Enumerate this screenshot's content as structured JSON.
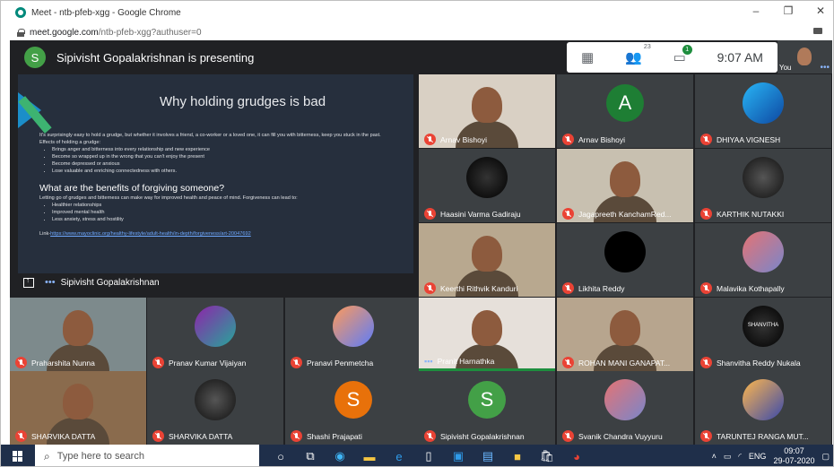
{
  "browser": {
    "tab_title": "Meet - ntb-pfeb-xgg - Google Chrome",
    "url_host": "meet.google.com",
    "url_path": "/ntb-pfeb-xgg?authuser=0",
    "controls": {
      "minimize": "–",
      "restore": "❐",
      "close": "✕"
    }
  },
  "meet": {
    "presenter_initial": "S",
    "presenting_text": "Sipivisht Gopalakrishnan is presenting",
    "participant_count": "23",
    "chat_badge": "1",
    "time": "9:07 AM",
    "self_label": "You",
    "presenter_label": "Sipivisht Gopalakrishnan",
    "slide": {
      "title": "Why holding grudges is bad",
      "intro": "It's surprisingly easy to hold a grudge, but whether it involves a friend, a co-worker or a loved one, it can fill you with bitterness, keep you stuck in the past.",
      "effects_heading": "Effects of holding a grudge:",
      "effects": [
        "Brings anger and bitterness into every relationship and new experience",
        "Become so wrapped up in the wrong that you can't enjoy the present",
        "Become depressed or anxious",
        "Lose valuable and enriching connectedness with others."
      ],
      "subtitle": "What are the benefits of forgiving someone?",
      "benefits_intro": "Letting go of grudges and bitterness can make way for improved health and peace of mind. Forgiveness can lead to:",
      "benefits": [
        "Healthier relationships",
        "Improved mental health",
        "Less anxiety, stress and hostility"
      ],
      "link_label": "Link-",
      "link_url": "https://www.mayoclinic.org/healthy-lifestyle/adult-health/in-depth/forgiveness/art-20047692"
    },
    "tiles": [
      {
        "name": "Arnav Bishoyi",
        "kind": "video"
      },
      {
        "name": "Arnav Bishoyi",
        "kind": "initial",
        "initial": "A",
        "color": "#1e7e34"
      },
      {
        "name": "DHIYAA VIGNESH",
        "kind": "photo"
      },
      {
        "name": "Haasini Varma Gadiraju",
        "kind": "photo"
      },
      {
        "name": "Jagapreeth KanchamRed...",
        "kind": "video"
      },
      {
        "name": "KARTHIK NUTAKKI",
        "kind": "photo"
      },
      {
        "name": "Keerthi Rithvik Kanduri",
        "kind": "video"
      },
      {
        "name": "Likhita Reddy",
        "kind": "photo"
      },
      {
        "name": "Malavika Kothapally",
        "kind": "photo"
      },
      {
        "name": "Praharshita Nunna",
        "kind": "video"
      },
      {
        "name": "Pranav Kumar Vijaiyan",
        "kind": "photo"
      },
      {
        "name": "Pranavi Penmetcha",
        "kind": "photo"
      },
      {
        "name": "Pranit Harnathka",
        "kind": "video"
      },
      {
        "name": "ROHAN MANI GANAPAT...",
        "kind": "video"
      },
      {
        "name": "Shanvitha Reddy Nukala",
        "kind": "photo",
        "photo_text": "SHANVITHA"
      },
      {
        "name": "SHARVIKA DATTA",
        "kind": "video"
      },
      {
        "name": "SHARVIKA DATTA",
        "kind": "photo"
      },
      {
        "name": "Shashi Prajapati",
        "kind": "initial",
        "initial": "S",
        "color": "#e8710a"
      },
      {
        "name": "Sipivisht Gopalakrishnan",
        "kind": "initial",
        "initial": "S",
        "color": "#43a047"
      },
      {
        "name": "Svanik Chandra Vuyyuru",
        "kind": "photo"
      },
      {
        "name": "TARUNTEJ RANGA MUT...",
        "kind": "photo"
      }
    ]
  },
  "taskbar": {
    "search_placeholder": "Type here to search",
    "language": "ENG",
    "clock_time": "09:07",
    "clock_date": "29-07-2020"
  },
  "colors": {
    "meet_bg": "#202124",
    "tile_bg": "#3c4043",
    "muted_red": "#ea4335",
    "taskbar": "#1f2f4a"
  }
}
